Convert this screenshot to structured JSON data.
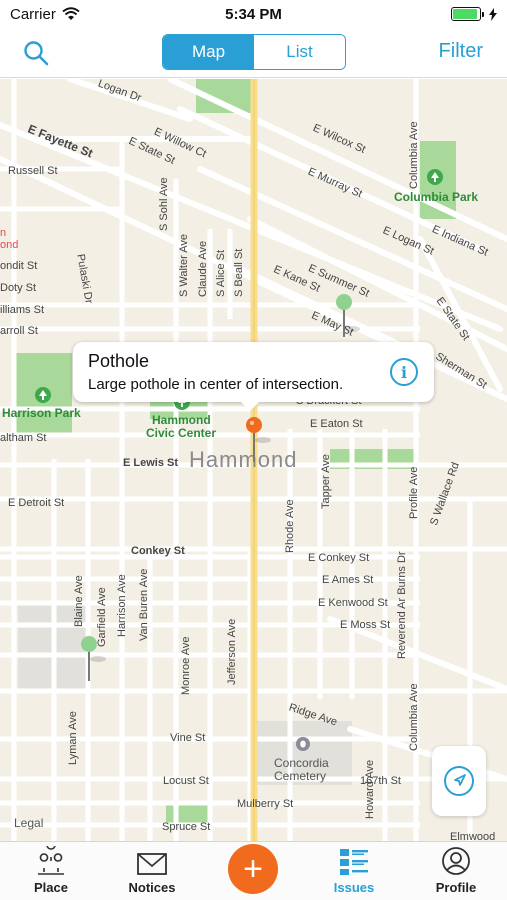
{
  "status_bar": {
    "carrier": "Carrier",
    "time": "5:34 PM"
  },
  "nav": {
    "segments": [
      {
        "label": "Map",
        "selected": true
      },
      {
        "label": "List",
        "selected": false
      }
    ],
    "filter_label": "Filter"
  },
  "map": {
    "town_label": "Hammond",
    "streets": {
      "logan_dr": "Logan Dr",
      "e_fayette_st": "E Fayette St",
      "e_willow_ct": "E Willow Ct",
      "e_state_st_top": "E State St",
      "e_wilcox_st": "E Wilcox St",
      "russell_st": "Russell St",
      "e_murray_st": "E Murray St",
      "columbia_ave_top": "Columbia Ave",
      "s_sohl_ave": "S Sohl Ave",
      "e_logan_st": "E Logan St",
      "e_indiana_st": "E Indiana St",
      "s_walter_ave": "S Walter Ave",
      "claude_ave": "Claude Ave",
      "s_alice_st": "S Alice St",
      "s_beall_st": "S Beall St",
      "pulaski_dr": "Pulaski Dr",
      "ondit_st": "ondit St",
      "doty_st": "Doty St",
      "e_kane_st": "E Kane St",
      "e_summer_st": "E Summer St",
      "e_may_st": "E May St",
      "illiams_st": "illiams St",
      "arroll_st": "arroll St",
      "e_state_st_right": "E State St",
      "sherman_st": "Sherman St",
      "s_drackert_st": "S Drackert St",
      "e_eaton_st": "E Eaton St",
      "altham_st": "altham St",
      "e_lewis_st": "E Lewis St",
      "rhode_ave": "Rhode Ave",
      "tapper_ave": "Tapper Ave",
      "profile_ave": "Profile Ave",
      "s_wallace_rd": "S Wallace Rd",
      "e_detroit_st": "E Detroit St",
      "conkey_st": "Conkey St",
      "e_conkey_st": "E Conkey St",
      "e_ames_st": "E Ames St",
      "e_kenwood_st": "E Kenwood St",
      "e_moss_st": "E Moss St",
      "reverend_ar_burns_dr": "Reverend Ar Burns Dr",
      "blaine_ave": "Blaine Ave",
      "garfield_ave": "Garfield Ave",
      "harrison_ave": "Harrison Ave",
      "van_buren_ave": "Van Buren Ave",
      "monroe_ave": "Monroe Ave",
      "jefferson_ave": "Jefferson Ave",
      "columbia_ave_bottom": "Columbia Ave",
      "ridge_ave": "Ridge Ave",
      "vine_st": "Vine St",
      "lyman_ave": "Lyman Ave",
      "locust_st": "Locust St",
      "st_167th": "167th St",
      "mulberry_st": "Mulberry St",
      "howard_ave": "Howard Ave",
      "spruce_st": "Spruce St",
      "elmwood": "Elmwood",
      "ond_left": "ond",
      "n_left": "n"
    },
    "places": {
      "columbia_park": "Columbia Park",
      "harrison_park": "Harrison Park",
      "civic_center_line1": "Hammond",
      "civic_center_line2": "Civic Center",
      "cemetery_line1": "Concordia",
      "cemetery_line2": "Cemetery"
    },
    "legal": "Legal"
  },
  "callout": {
    "title": "Pothole",
    "description": "Large pothole in center of intersection.",
    "info_glyph": "i"
  },
  "tabbar": {
    "tabs": [
      {
        "label": "Place",
        "icon": "place-pins-icon"
      },
      {
        "label": "Notices",
        "icon": "envelope-icon"
      },
      {
        "label": "Issues",
        "icon": "issues-list-icon",
        "active": true
      },
      {
        "label": "Profile",
        "icon": "profile-icon"
      }
    ],
    "fab_glyph": "+"
  },
  "colors": {
    "accent": "#2a9fd6",
    "fab": "#f06b1e",
    "pin_green": "#8fd18f",
    "pin_orange": "#f06b1e",
    "map_bg": "#f3efe5",
    "park": "#a8d99a"
  }
}
